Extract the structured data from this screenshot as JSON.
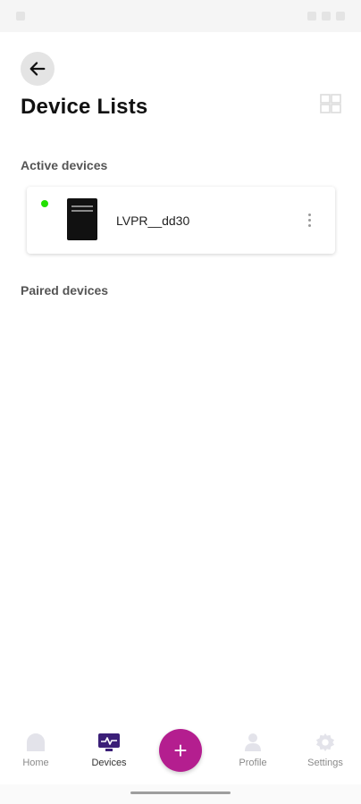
{
  "header": {
    "title": "Device Lists",
    "back_icon": "arrow-left-icon",
    "view_toggle_icon": "grid-view-icon"
  },
  "sections": {
    "active_title": "Active devices",
    "paired_title": "Paired devices"
  },
  "active_devices": [
    {
      "name": "LVPR__dd30",
      "status": "online",
      "status_color": "#22e000",
      "image": "air-purifier-device-icon"
    }
  ],
  "bottom_nav": {
    "items": [
      {
        "label": "Home",
        "icon": "home-icon",
        "active": false
      },
      {
        "label": "Devices",
        "icon": "devices-icon",
        "active": true
      },
      {
        "label": "Profile",
        "icon": "profile-icon",
        "active": false
      },
      {
        "label": "Settings",
        "icon": "settings-icon",
        "active": false
      }
    ],
    "fab_label": "+",
    "fab_icon": "plus-icon"
  },
  "colors": {
    "accent": "#b41e8f",
    "active_nav": "#3b1f78",
    "online": "#22e000",
    "inactive_nav": "#e3e3ea"
  }
}
